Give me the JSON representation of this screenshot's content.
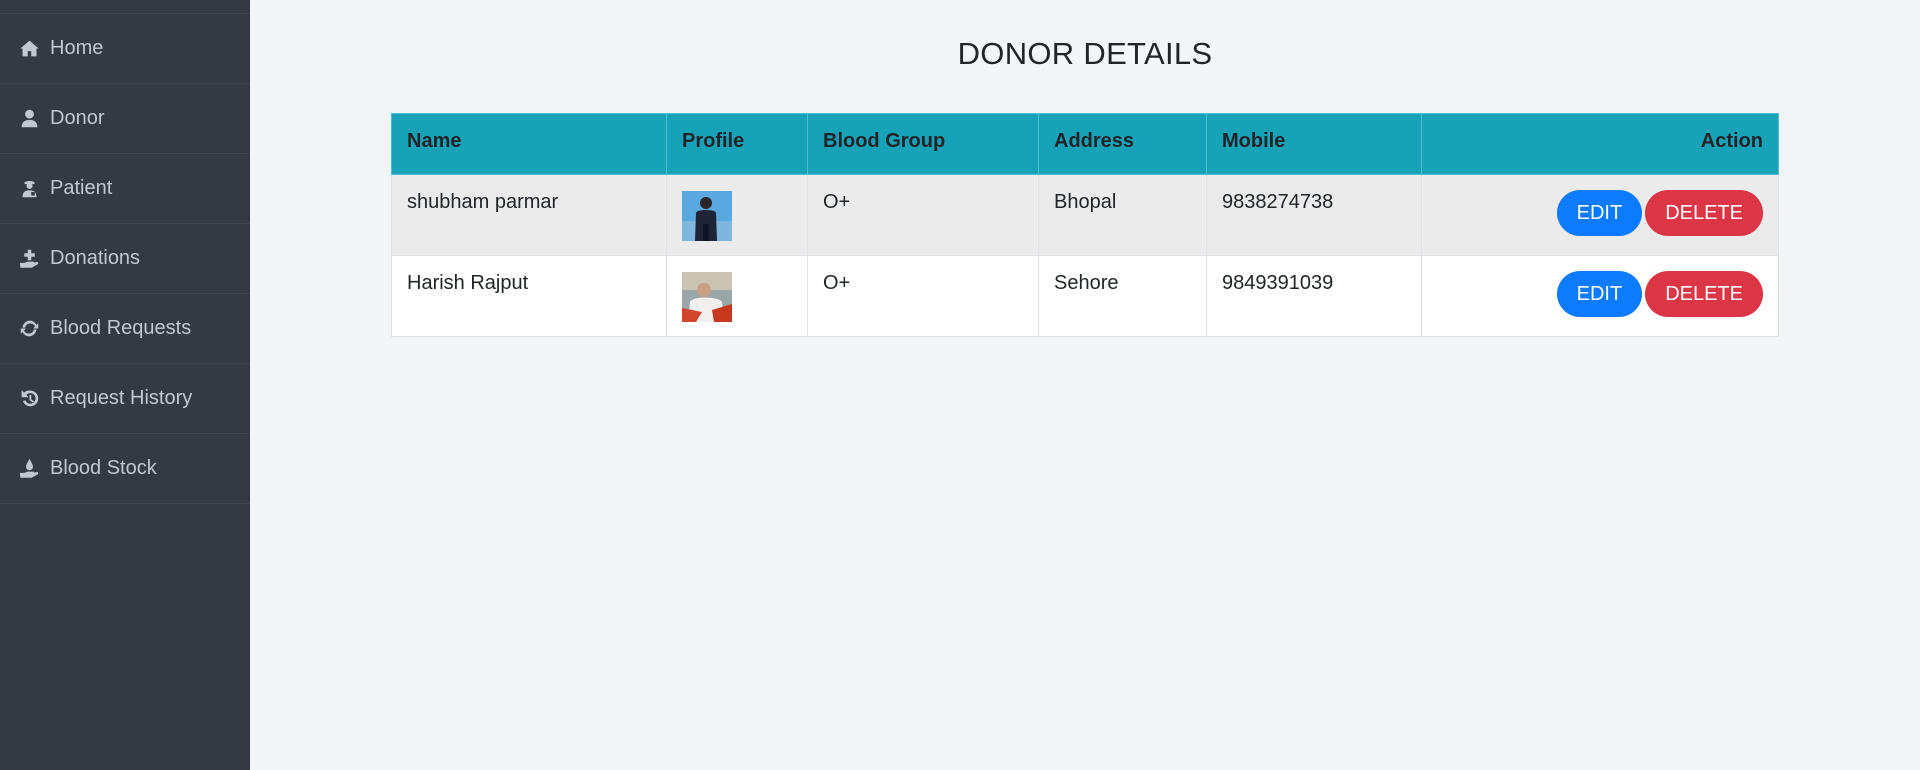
{
  "sidebar": {
    "items": [
      {
        "label": "Home",
        "icon": "home-icon"
      },
      {
        "label": "Donor",
        "icon": "user-icon"
      },
      {
        "label": "Patient",
        "icon": "patient-icon"
      },
      {
        "label": "Donations",
        "icon": "hand-holding-medical-icon"
      },
      {
        "label": "Blood Requests",
        "icon": "sync-icon"
      },
      {
        "label": "Request History",
        "icon": "history-icon"
      },
      {
        "label": "Blood Stock",
        "icon": "hand-holding-water-icon"
      }
    ]
  },
  "main": {
    "title": "DONOR DETAILS",
    "table": {
      "headers": {
        "name": "Name",
        "profile": "Profile",
        "blood_group": "Blood Group",
        "address": "Address",
        "mobile": "Mobile",
        "action": "Action"
      },
      "rows": [
        {
          "name": "shubham parmar",
          "blood_group": "O+",
          "address": "Bhopal",
          "mobile": "9838274738",
          "edit_label": "EDIT",
          "delete_label": "DELETE"
        },
        {
          "name": "Harish Rajput",
          "blood_group": "O+",
          "address": "Sehore",
          "mobile": "9849391039",
          "edit_label": "EDIT",
          "delete_label": "DELETE"
        }
      ]
    }
  },
  "colors": {
    "sidebar_bg": "#343a40",
    "sidebar_text": "#c2c7d0",
    "table_header_bg": "#17a2b8",
    "edit_button": "#0d7bff",
    "delete_button": "#dc3545"
  }
}
